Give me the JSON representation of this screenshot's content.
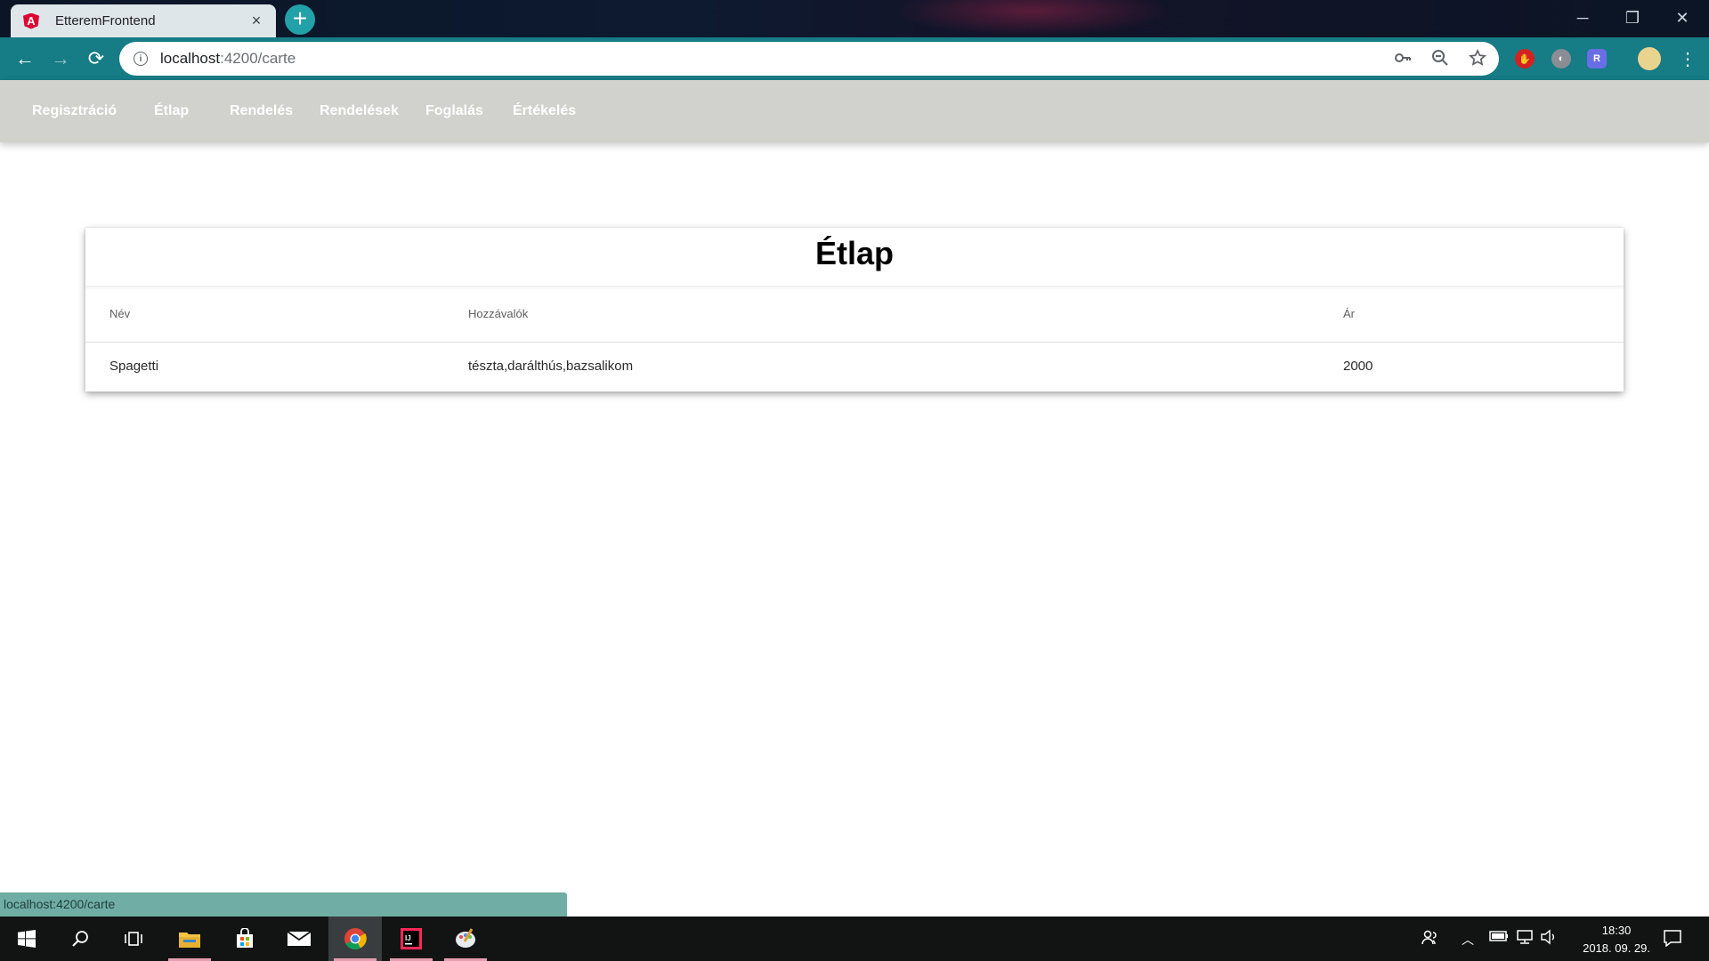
{
  "browser": {
    "tab_title": "EtteremFrontend",
    "tab_close": "×",
    "new_tab": "+",
    "url_host": "localhost",
    "url_path": ":4200/carte",
    "window_controls": {
      "minimize": "─",
      "restore": "❐",
      "close": "✕"
    },
    "nav": {
      "back": "←",
      "forward": "→",
      "reload": "⟳"
    },
    "icons": [
      "info-icon",
      "key-icon",
      "zoom-icon",
      "star-icon",
      "extension-icon",
      "profile-icon",
      "menu-icon"
    ]
  },
  "appnav": {
    "items": [
      "Regisztráció",
      "Étlap",
      "Rendelés",
      "Rendelések",
      "Foglalás",
      "Értékelés"
    ]
  },
  "card": {
    "title": "Étlap",
    "columns": [
      "Név",
      "Hozzávalók",
      "Ár"
    ],
    "rows": [
      {
        "name": "Spagetti",
        "ingredients": "tészta,darálthús,bazsalikom",
        "price": "2000"
      }
    ]
  },
  "status_bar": {
    "url": "localhost:4200/carte"
  },
  "taskbar": {
    "time": "18:30",
    "date": "2018. 09. 29.",
    "apps": [
      "start-icon",
      "search-icon",
      "task-view-icon",
      "file-explorer-icon",
      "store-icon",
      "mail-icon",
      "chrome-icon",
      "intellij-icon",
      "paint-icon"
    ]
  },
  "colors": {
    "toolbar": "#167c86",
    "nav_bg": "#d1d1cd",
    "status_bubble": "#6fada5",
    "taskbar": "#121414"
  }
}
